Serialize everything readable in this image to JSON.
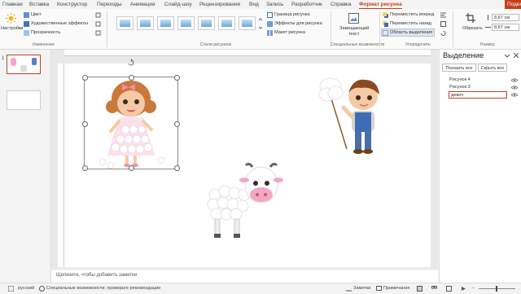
{
  "tabs": [
    "Главная",
    "Вставка",
    "Конструктор",
    "Переходы",
    "Анимация",
    "Слайд-шоу",
    "Рецензирование",
    "Вид",
    "Запись",
    "Разработчик",
    "Справка",
    "Формат рисунка"
  ],
  "share_label": "Подел",
  "ribbon": {
    "settings_label": "Настройки",
    "color_label": "Цвет",
    "artistic_label": "Художественные эффекты",
    "transparency_label": "Прозрачность",
    "group_change": "Изменение",
    "group_styles": "Стили рисунков",
    "border_label": "Граница рисунка",
    "effects_label": "Эффекты для рисунка",
    "layout_label": "Макет рисунка",
    "alt_text_label_1": "Замещающий",
    "alt_text_label_2": "текст",
    "group_accessibility": "Специальные возможности",
    "bring_forward_label": "Переместить вперед",
    "send_backward_label": "Переместить назад",
    "selection_pane_label": "Область выделения",
    "group_arrange": "Упорядочить",
    "crop_label": "Обрезать",
    "height_value": "8,67 см",
    "width_value": "8,67 см",
    "group_size": "Размер"
  },
  "slide_thumb_number": "1",
  "notes_placeholder": "Щелкните, чтобы добавить заметки",
  "selection_pane": {
    "title": "Выделение",
    "show_all": "Показать все",
    "hide_all": "Скрыть все",
    "items": [
      "Рисунок 4",
      "Рисунок 3",
      "девоч"
    ]
  },
  "status": {
    "language": "русский",
    "accessibility": "Специальные возможности: проверьте рекомендации",
    "notes": "Заметки",
    "comments": "Примечания"
  },
  "colors": {
    "accent": "#c43e1c",
    "pink": "#f4a7c3",
    "skin": "#f5c9a5"
  }
}
